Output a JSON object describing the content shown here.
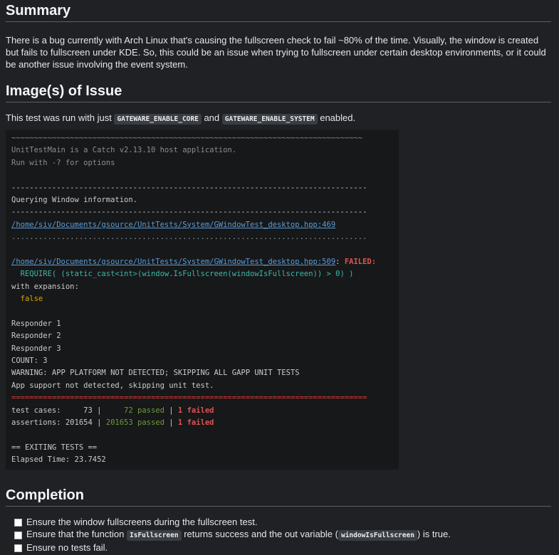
{
  "summary": {
    "heading": "Summary",
    "text": "There is a bug currently with Arch Linux that's causing the fullscreen check to fail ~80% of the time. Visually, the window is created but fails to fullscreen under KDE. So, this could be an issue when trying to fullscreen under certain desktop environments, or it could be another issue involving the event system."
  },
  "images": {
    "heading": "Image(s) of Issue",
    "pre": "This test was run with just ",
    "flag1": "GATEWARE_ENABLE_CORE",
    "and": " and ",
    "flag2": "GATEWARE_ENABLE_SYSTEM",
    "post": " enabled."
  },
  "console": {
    "tildes": "~~~~~~~~~~~~~~~~~~~~~~~~~~~~~~~~~~~~~~~~~~~~~~~~~~~~~~~~~~~~~~~~~~~~~~~~~~~~~~",
    "line_app": "UnitTestMain is a Catch v2.13.10 host application.",
    "line_run": "Run with -? for options",
    "dashes": "-------------------------------------------------------------------------------",
    "querying": "Querying Window information.",
    "path1": "/home/siv/Documents/gsource/UnitTests/System/GWindowTest_desktop.hpp:469",
    "dots": "...............................................................................",
    "path2": "/home/siv/Documents/gsource/UnitTests/System/GWindowTest_desktop.hpp:509",
    "colon": ": ",
    "failed": "FAILED:",
    "require": "  REQUIRE( (static_cast<int>(window.IsFullscreen(windowIsFullscreen)) > 0) )",
    "with_expansion": "with expansion:",
    "false_val": "  false",
    "resp1": "Responder 1",
    "resp2": "Responder 2",
    "resp3": "Responder 3",
    "count": "COUNT: 3",
    "warning": "WARNING: APP PLATFORM NOT DETECTED; SKIPPING ALL GAPP UNIT TESTS",
    "app_support": "App support not detected, skipping unit test.",
    "equals": "===============================================================================",
    "tc_label": "test cases:     73 | ",
    "tc_passed": "    72 passed",
    "sep": " | ",
    "tc_failed": "1 failed",
    "as_label": "assertions: 201654 | ",
    "as_passed": "201653 passed",
    "as_failed": "1 failed",
    "exiting": "== EXITING TESTS ==",
    "elapsed": "Elapsed Time: 23.7452"
  },
  "completion": {
    "heading": "Completion",
    "task1": "Ensure the window fullscreens during the fullscreen test.",
    "task2_pre": "Ensure that the function ",
    "task2_code1": "IsFullscreen",
    "task2_mid": " returns success and the out variable (",
    "task2_code2": "windowIsFullscreen",
    "task2_post": ") is true.",
    "task3": "Ensure no tests fail."
  }
}
